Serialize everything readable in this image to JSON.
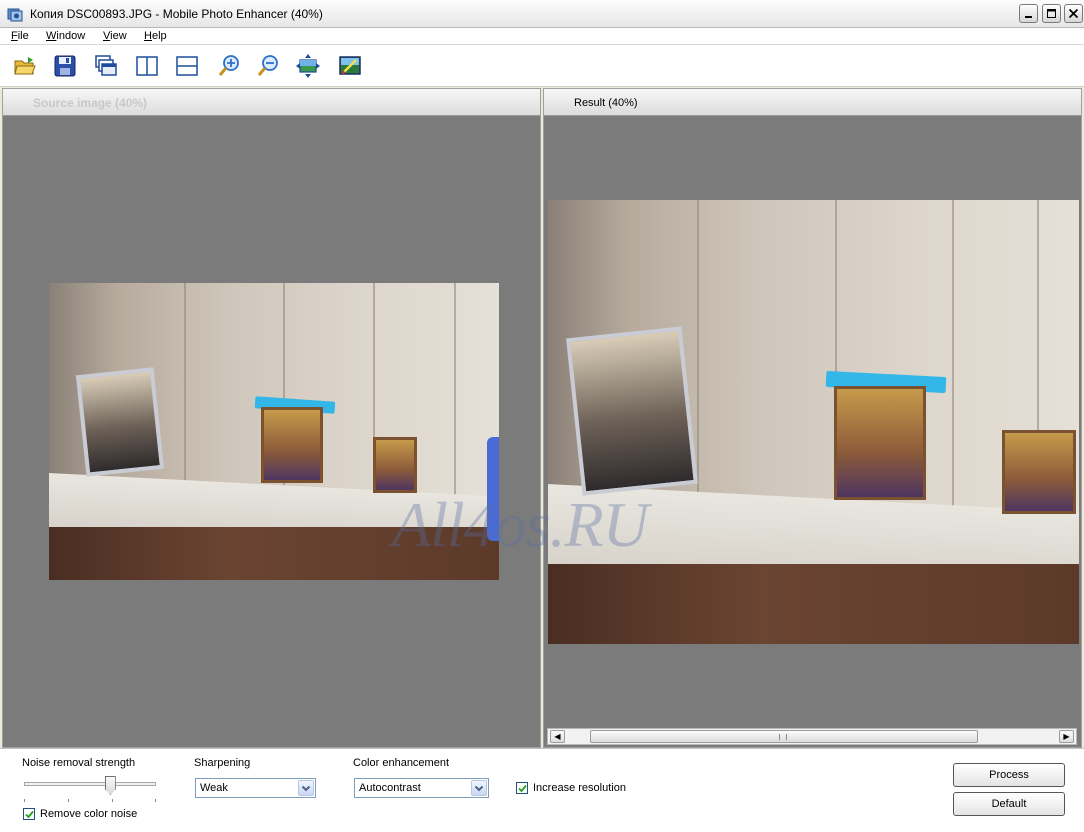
{
  "window": {
    "title": "Копия DSC00893.JPG - Mobile Photo Enhancer (40%)"
  },
  "menu": {
    "items": [
      {
        "accel": "F",
        "rest": "ile"
      },
      {
        "accel": "W",
        "rest": "indow"
      },
      {
        "accel": "V",
        "rest": "iew"
      },
      {
        "accel": "H",
        "rest": "elp"
      }
    ]
  },
  "toolbar": {
    "icons": [
      "open-folder-icon",
      "save-icon",
      "cascade-windows-icon",
      "split-vertical-icon",
      "split-horizontal-icon",
      "zoom-in-icon",
      "zoom-out-icon",
      "fit-to-window-icon",
      "edit-image-icon"
    ]
  },
  "panels": {
    "source_title": "Source image (40%)",
    "result_title": "Result (40%)"
  },
  "watermark": "All4os.RU",
  "controls": {
    "noise_label": "Noise removal strength",
    "noise_level": 0.65,
    "remove_color_noise_label": "Remove color noise",
    "remove_color_noise_checked": true,
    "sharpening_label": "Sharpening",
    "sharpening_value": "Weak",
    "color_label": "Color enhancement",
    "color_value": "Autocontrast",
    "increase_resolution_label": "Increase resolution",
    "increase_resolution_checked": true,
    "process_label": "Process",
    "default_label": "Default"
  },
  "colors": {
    "canvas": "#7b7b7b",
    "accent_cyan": "#33b7e8"
  }
}
